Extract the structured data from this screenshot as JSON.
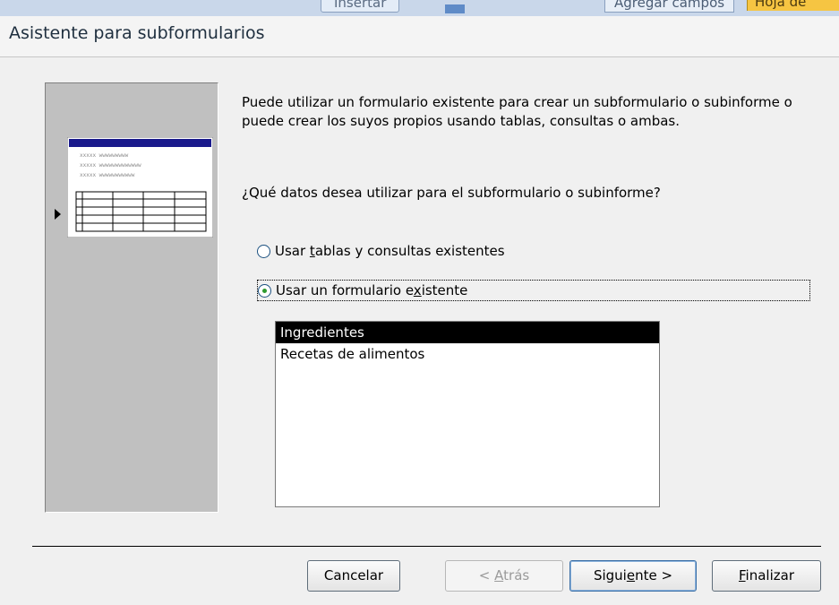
{
  "background_strip": {
    "insert_label": "Insertar",
    "tab1_label": "Agregar campos",
    "tab2_label": "Hoja de"
  },
  "window": {
    "title": "Asistente para subformularios"
  },
  "description": "Puede utilizar un formulario existente para crear un subformulario o subinforme o puede crear los suyos propios usando tablas, consultas o ambas.",
  "question": "¿Qué datos desea utilizar para el subformulario o subinforme?",
  "options": [
    {
      "label_pre": "Usar ",
      "label_u": "t",
      "label_post": "ablas y consultas existentes",
      "checked": false
    },
    {
      "label_pre": "Usar un formulario e",
      "label_u": "x",
      "label_post": "istente",
      "checked": true
    }
  ],
  "forms_list": {
    "items": [
      "Ingredientes",
      "Recetas de alimentos"
    ],
    "selected_index": 0
  },
  "buttons": {
    "cancel": "Cancelar",
    "back_pre": "< ",
    "back_u": "A",
    "back_post": "trás",
    "next_pre": "Sigui",
    "next_u": "e",
    "next_post": "nte >",
    "finish_pre": "",
    "finish_u": "F",
    "finish_post": "inalizar"
  },
  "colors": {
    "selection": "#000000",
    "radio_dot": "#2f9a2f",
    "thumb_header": "#1a1a8c"
  }
}
